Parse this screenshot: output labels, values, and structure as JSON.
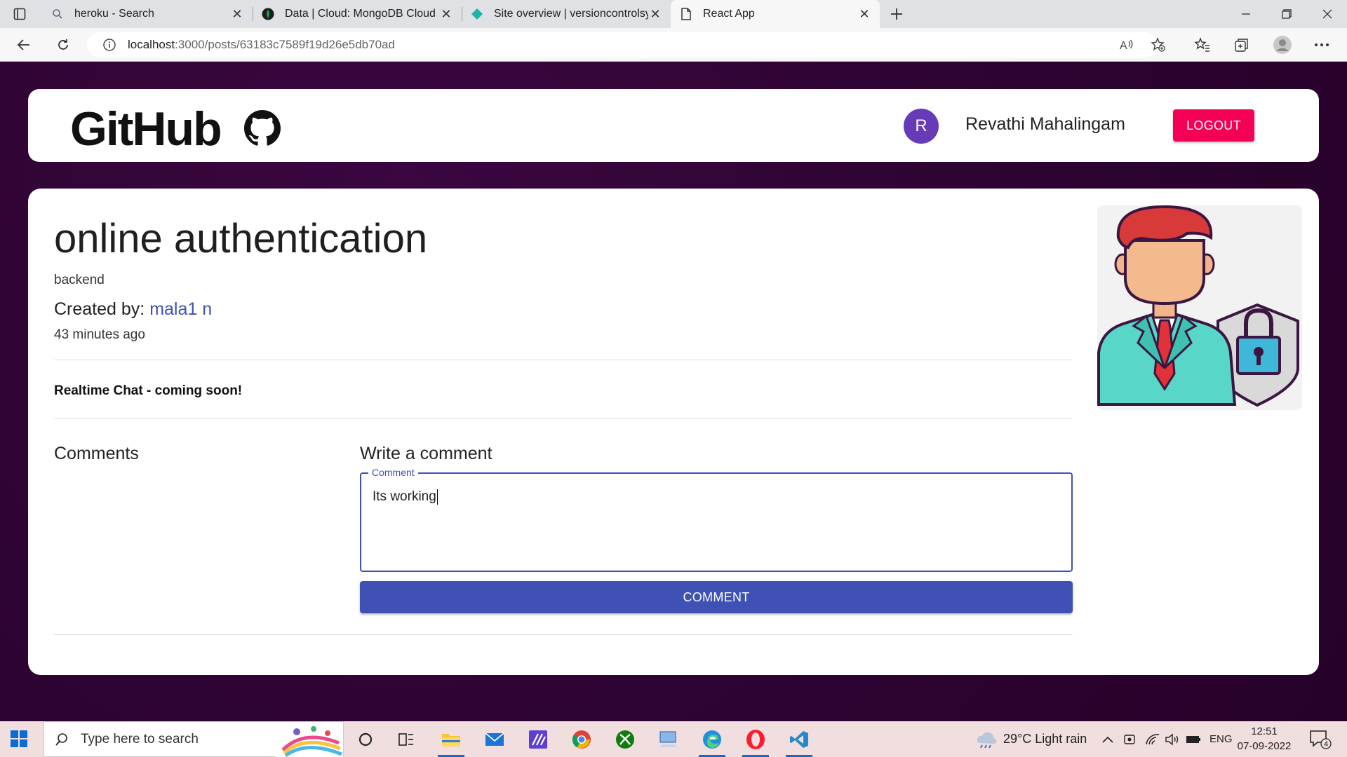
{
  "browser": {
    "tabs": [
      {
        "title": "heroku - Search",
        "active": false
      },
      {
        "title": "Data | Cloud: MongoDB Cloud",
        "active": false
      },
      {
        "title": "Site overview | versioncontrolsys",
        "active": false
      },
      {
        "title": "React App",
        "active": true
      }
    ],
    "url_host": "localhost",
    "url_path": ":3000/posts/63183c7589f19d26e5db70ad"
  },
  "header": {
    "brand": "GitHub",
    "avatar_letter": "R",
    "username": "Revathi Mahalingam",
    "logout_label": "LOGOUT"
  },
  "post": {
    "title": "online authentication",
    "tag": "backend",
    "created_by_label": "Created by: ",
    "author": "mala1 n",
    "time_ago": "43 minutes ago",
    "notice": "Realtime Chat - coming soon!"
  },
  "comments": {
    "heading": "Comments",
    "write_heading": "Write a comment",
    "field_label": "Comment",
    "field_value": "Its working",
    "submit_label": "COMMENT"
  },
  "taskbar": {
    "search_placeholder": "Type here to search",
    "weather": "29°C  Light rain",
    "language": "ENG",
    "time": "12:51",
    "date": "07-09-2022",
    "notification_count": "4"
  },
  "colors": {
    "page_bg": "#2c0330",
    "primary": "#3f51b5",
    "logout": "#f50057",
    "avatar": "#673ab7"
  }
}
